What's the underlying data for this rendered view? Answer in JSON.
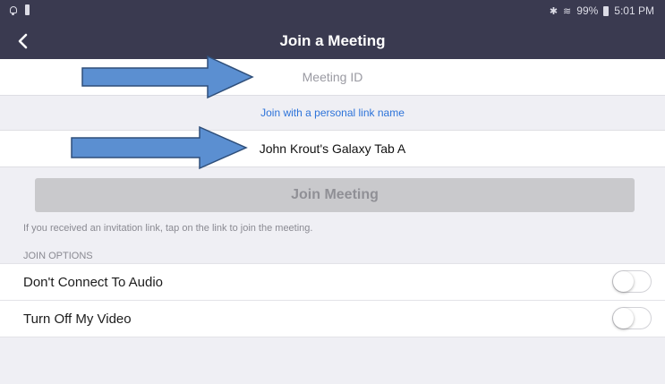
{
  "status_bar": {
    "battery": "99%",
    "time": "5:01 PM",
    "icons": [
      "alarm-icon",
      "notification-icon",
      "bluetooth-icon",
      "wifi-icon",
      "battery-icon"
    ]
  },
  "header": {
    "title": "Join a Meeting",
    "back_icon": "chevron-left-icon"
  },
  "meeting_id": {
    "placeholder": "Meeting ID",
    "value": ""
  },
  "personal_link": {
    "label": "Join with a personal link name"
  },
  "name_field": {
    "value": "John Krout's Galaxy Tab A"
  },
  "join_button": {
    "label": "Join Meeting",
    "enabled": false
  },
  "invite_hint": "If you received an invitation link, tap on the link to join the meeting.",
  "join_options": {
    "header": "JOIN OPTIONS",
    "items": [
      {
        "label": "Don't Connect To Audio",
        "on": false
      },
      {
        "label": "Turn Off My Video",
        "on": false
      }
    ]
  },
  "annotations": {
    "arrow_color": "#5b8fd1",
    "arrow_stroke": "#2f4f7a"
  }
}
